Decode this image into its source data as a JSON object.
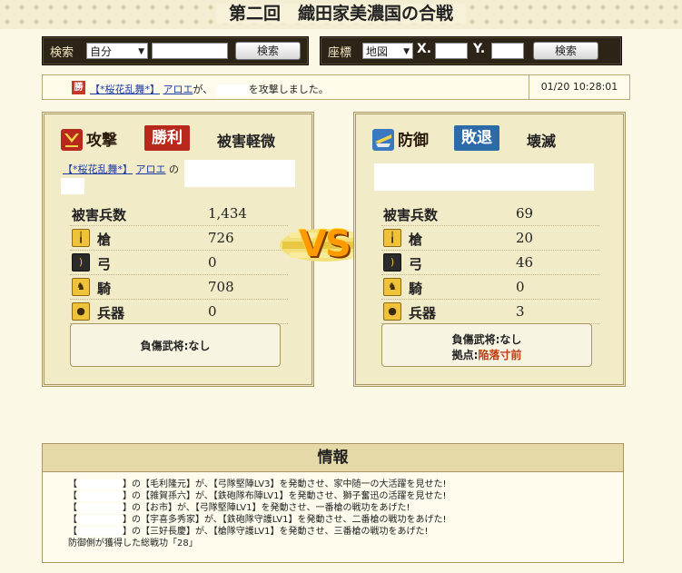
{
  "page_title": "第二回　織田家美濃国の合戦",
  "search": {
    "label": "検索",
    "select_value": "自分",
    "input_value": "",
    "button": "検索"
  },
  "coords": {
    "label": "座標",
    "select_value": "地図",
    "x_label": "X.",
    "x_value": "",
    "y_label": "Y.",
    "y_value": "",
    "button": "検索"
  },
  "log": {
    "result_icon": "勝",
    "alliance": "【*桜花乱舞*】",
    "player": "アロエ",
    "text_ga": "が、",
    "text_rest": "を攻撃しました。",
    "time": "01/20 10:28:01"
  },
  "attacker": {
    "label": "攻撃",
    "badge": "勝利",
    "damage": "被害軽微",
    "alliance": "【*桜花乱舞*】",
    "player": "アロエ",
    "text_no": "の",
    "stats": [
      {
        "label": "被害兵数",
        "value": "1,434",
        "icon": ""
      },
      {
        "label": "槍",
        "value": "726",
        "icon": "spear-icon"
      },
      {
        "label": "弓",
        "value": "0",
        "icon": "bow-icon"
      },
      {
        "label": "騎",
        "value": "708",
        "icon": "horse-icon"
      },
      {
        "label": "兵器",
        "value": "0",
        "icon": "siege-icon"
      }
    ],
    "injury": "負傷武将:なし",
    "colors": {
      "icon_bg": "#b8281c",
      "badge_bg": "#b8281c"
    }
  },
  "defender": {
    "label": "防御",
    "badge": "敗退",
    "damage": "壊滅",
    "stats": [
      {
        "label": "被害兵数",
        "value": "69",
        "icon": ""
      },
      {
        "label": "槍",
        "value": "20",
        "icon": "spear-icon"
      },
      {
        "label": "弓",
        "value": "46",
        "icon": "bow-icon"
      },
      {
        "label": "騎",
        "value": "0",
        "icon": "horse-icon"
      },
      {
        "label": "兵器",
        "value": "3",
        "icon": "siege-icon"
      }
    ],
    "injury": "負傷武将:なし",
    "base_label": "拠点:",
    "base_value": "陥落寸前",
    "colors": {
      "icon_bg": "#3a78c0",
      "badge_bg": "#2d6aa8"
    }
  },
  "vs_text": "VS",
  "info": {
    "title": "情報",
    "lines": [
      {
        "pre": "【",
        "post": "】の【毛利隆元】が、【弓隊堅陣LV3】を発動させ、家中随一の大活躍を見せた!"
      },
      {
        "pre": "【",
        "post": "】の【雑賀孫六】が、【鉄砲隊布陣LV1】を発動させ、獅子奮迅の活躍を見せた!"
      },
      {
        "pre": "【",
        "post": "】の【お市】が、【弓隊堅陣LV1】を発動させ、一番槍の戦功をあげた!"
      },
      {
        "pre": "【",
        "post": "】の【宇喜多秀家】が、【鉄砲隊守護LV1】を発動させ、二番槍の戦功をあげた!"
      },
      {
        "pre": "【",
        "post": "】の【三好長慶】が、【槍隊守護LV1】を発動させ、三番槍の戦功をあげた!"
      }
    ],
    "footer": "防御側が獲得した総戦功「28」"
  }
}
